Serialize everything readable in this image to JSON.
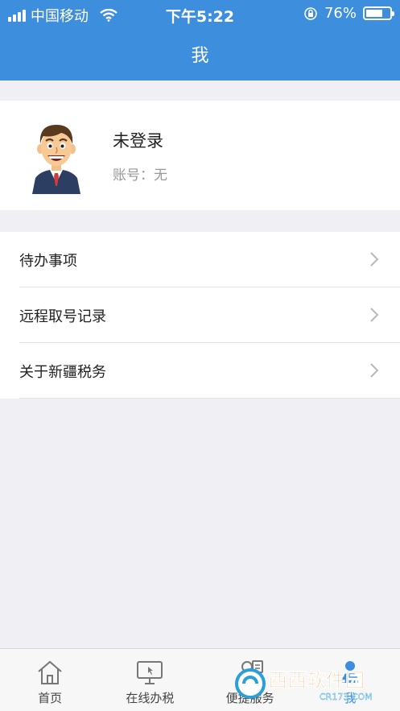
{
  "status_bar": {
    "carrier": "中国移动",
    "time": "下午5:22",
    "battery_percent": "76%",
    "battery_level": 0.76
  },
  "nav": {
    "title": "我"
  },
  "profile": {
    "name": "未登录",
    "account": "账号：无"
  },
  "menu": {
    "items": [
      {
        "label": "待办事项"
      },
      {
        "label": "远程取号记录"
      },
      {
        "label": "关于新疆税务"
      }
    ]
  },
  "tabs": [
    {
      "label": "首页",
      "icon": "home-icon",
      "active": false
    },
    {
      "label": "在线办税",
      "icon": "monitor-icon",
      "active": false
    },
    {
      "label": "便捷服务",
      "icon": "service-icon",
      "active": false
    },
    {
      "label": "我",
      "icon": "user-icon",
      "active": true
    }
  ],
  "watermark": {
    "text": "西西软件园",
    "sub": "CR173.COM"
  },
  "colors": {
    "primary": "#3e8ede",
    "background": "#efeff4"
  }
}
